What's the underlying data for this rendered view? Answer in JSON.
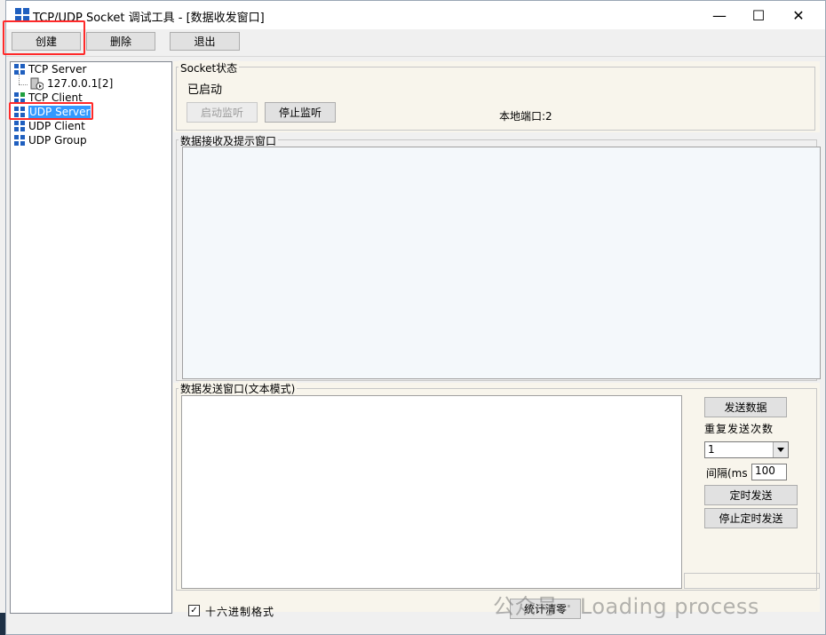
{
  "window": {
    "title": "TCP/UDP Socket 调试工具 - [数据收发窗口]",
    "minimize_glyph": "—",
    "maximize_glyph": "☐",
    "close_glyph": "✕"
  },
  "toolbar": {
    "create_label": "创建",
    "delete_label": "删除",
    "exit_label": "退出"
  },
  "tree": {
    "tcp_server": "TCP Server",
    "tcp_server_child": "127.0.0.1[2]",
    "tcp_client": "TCP Client",
    "udp_server": "UDP Server",
    "udp_client": "UDP Client",
    "udp_group": "UDP Group"
  },
  "socket_status": {
    "group_label": "Socket状态",
    "state": "已启动",
    "start_listen": "启动监听",
    "stop_listen": "停止监听",
    "local_port": "本地端口:2"
  },
  "receive": {
    "group_label": "数据接收及提示窗口"
  },
  "send": {
    "group_label": "数据发送窗口(文本模式)",
    "send_button": "发送数据",
    "repeat_label": "重复发送次数",
    "repeat_value": "1",
    "interval_label": "间隔(ms",
    "interval_value": "100",
    "timed_send": "定时发送",
    "stop_timed_send": "停止定时发送"
  },
  "footer": {
    "hex_checkbox_mark": "✓",
    "hex_label": "十六进制格式",
    "clear_stats": "统计清零"
  },
  "watermark": {
    "text": "公众号 · Loading process"
  },
  "colors": {
    "selection": "#3399ff",
    "highlight_box": "#ff2a2a",
    "panel_bg": "#f8f5ec"
  }
}
